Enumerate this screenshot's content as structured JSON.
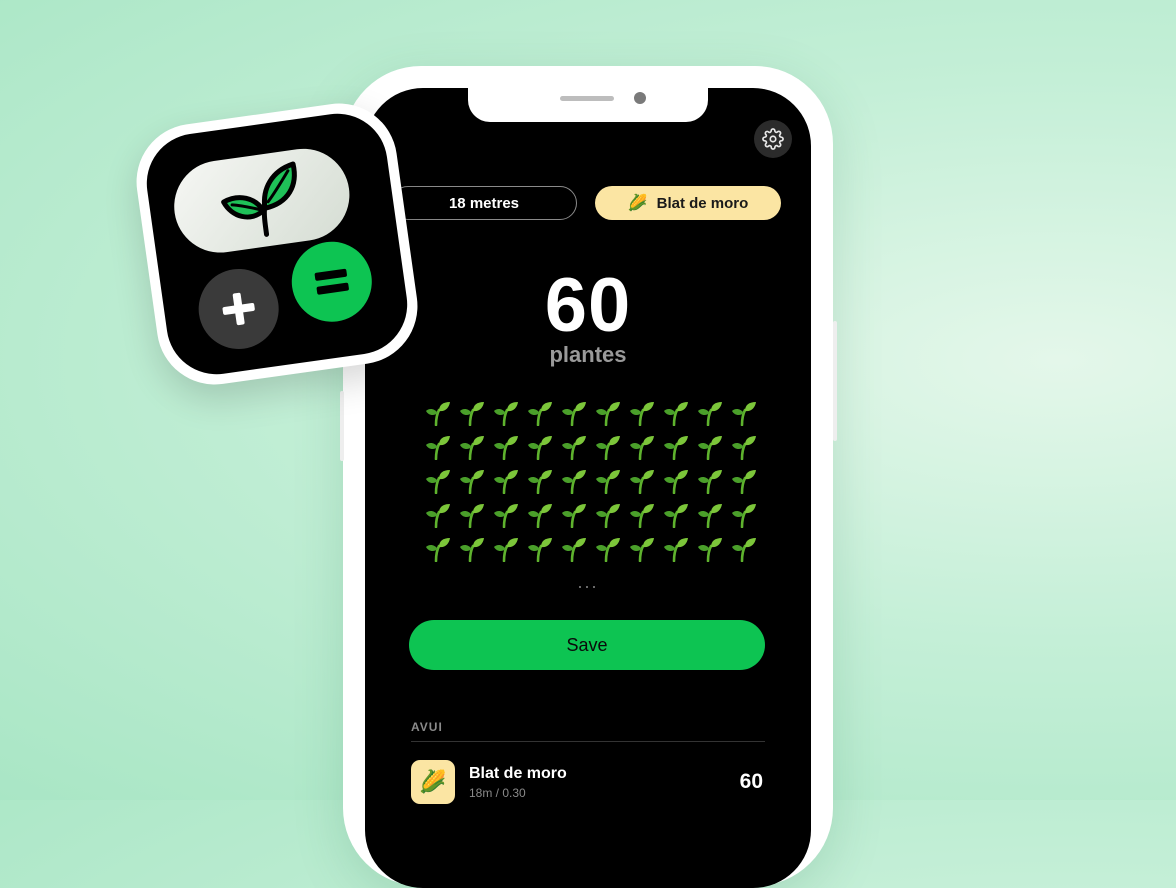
{
  "colors": {
    "background": "#bdebd2",
    "screen": "#000000",
    "accent_green": "#0dc452",
    "crop_yellow": "#fbe5a3",
    "muted_text": "#8a8a8a"
  },
  "app_icon": {
    "display_icon": "seedling-leaf-icon",
    "keys": [
      {
        "icon": "plus-icon"
      },
      {
        "icon": "equals-icon"
      }
    ]
  },
  "header": {
    "settings_icon": "gear-icon"
  },
  "selectors": {
    "length_label": "18 metres",
    "crop_emoji": "🌽",
    "crop_label": "Blat de moro"
  },
  "result": {
    "count": "60",
    "unit": "plantes",
    "plant_icon": "sprout-icon",
    "sprouts_shown": 50,
    "more_indicator": "..."
  },
  "actions": {
    "save_label": "Save"
  },
  "history": {
    "section_label": "AVUI",
    "entries": [
      {
        "emoji": "🌽",
        "name": "Blat de moro",
        "detail": "18m / 0.30",
        "value": "60"
      }
    ]
  }
}
